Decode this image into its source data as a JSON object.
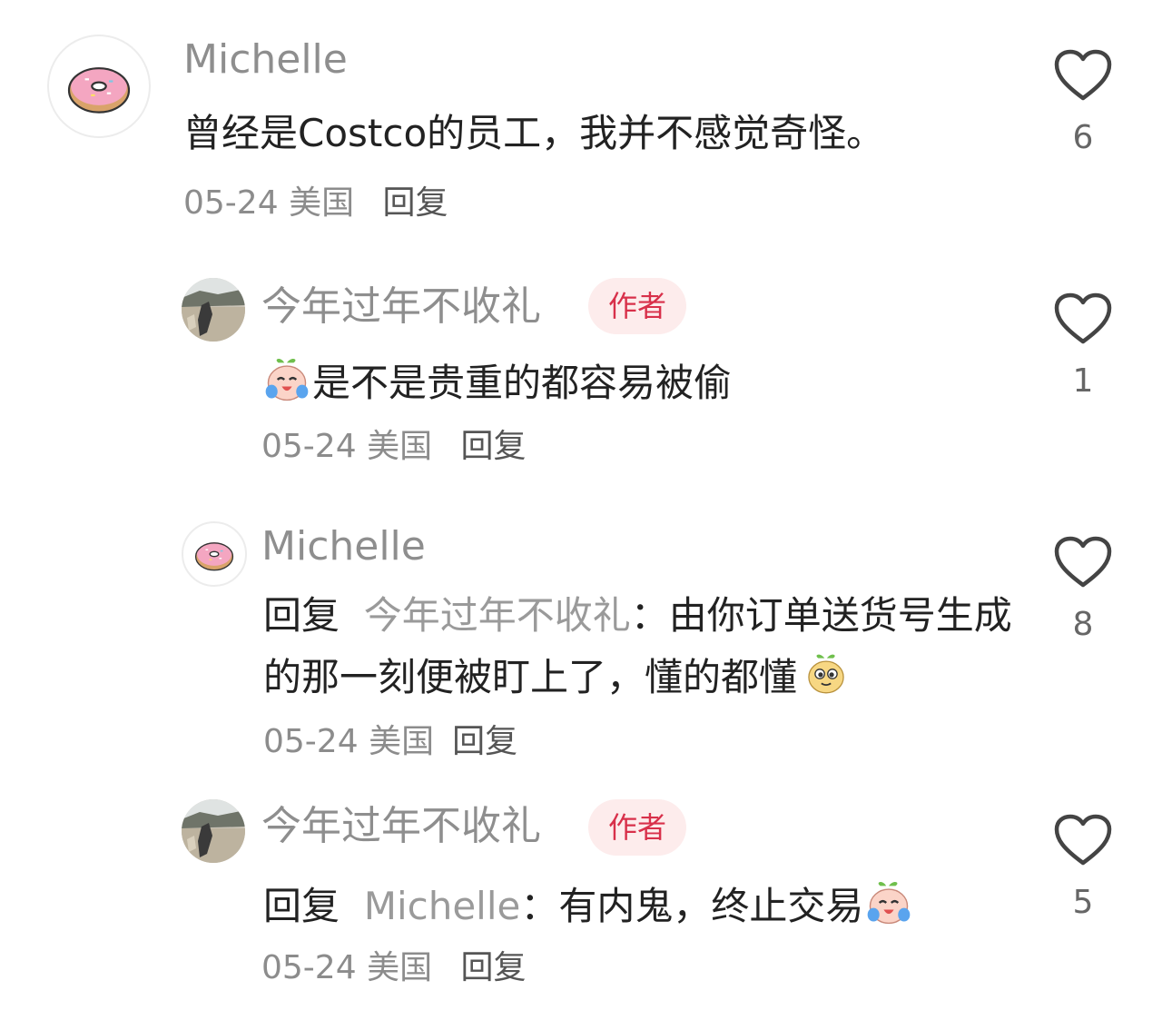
{
  "comments": [
    {
      "username": "Michelle",
      "text": "曾经是Costco的员工，我并不感觉奇怪。",
      "date": "05-24",
      "location": "美国",
      "reply_label": "回复",
      "likes": "6"
    },
    {
      "username": "今年过年不收礼",
      "badge": "作者",
      "text": "是不是贵重的都容易被偷",
      "date": "05-24",
      "location": "美国",
      "reply_label": "回复",
      "likes": "1"
    },
    {
      "username": "Michelle",
      "reply_prefix": "回复",
      "reply_to": "今年过年不收礼",
      "colon": "：",
      "text": "由你订单送货号生成的那一刻便被盯上了，懂的都懂",
      "date": "05-24",
      "location": "美国",
      "reply_label": "回复",
      "likes": "8"
    },
    {
      "username": "今年过年不收礼",
      "badge": "作者",
      "reply_prefix": "回复",
      "reply_to": "Michelle",
      "colon": "：",
      "text": "有内鬼，终止交易",
      "date": "05-24",
      "location": "美国",
      "reply_label": "回复",
      "likes": "5"
    }
  ],
  "colors": {
    "author_badge_bg": "#fdecec",
    "author_badge_text": "#d8304a",
    "username": "#8e8e8e",
    "meta": "#8c8c8c"
  },
  "icons": {
    "like": "heart-outline-icon",
    "donut_avatar": "donut-icon",
    "emoji_cry": "crying-laughing-emoji",
    "emoji_smug": "smug-face-emoji"
  }
}
